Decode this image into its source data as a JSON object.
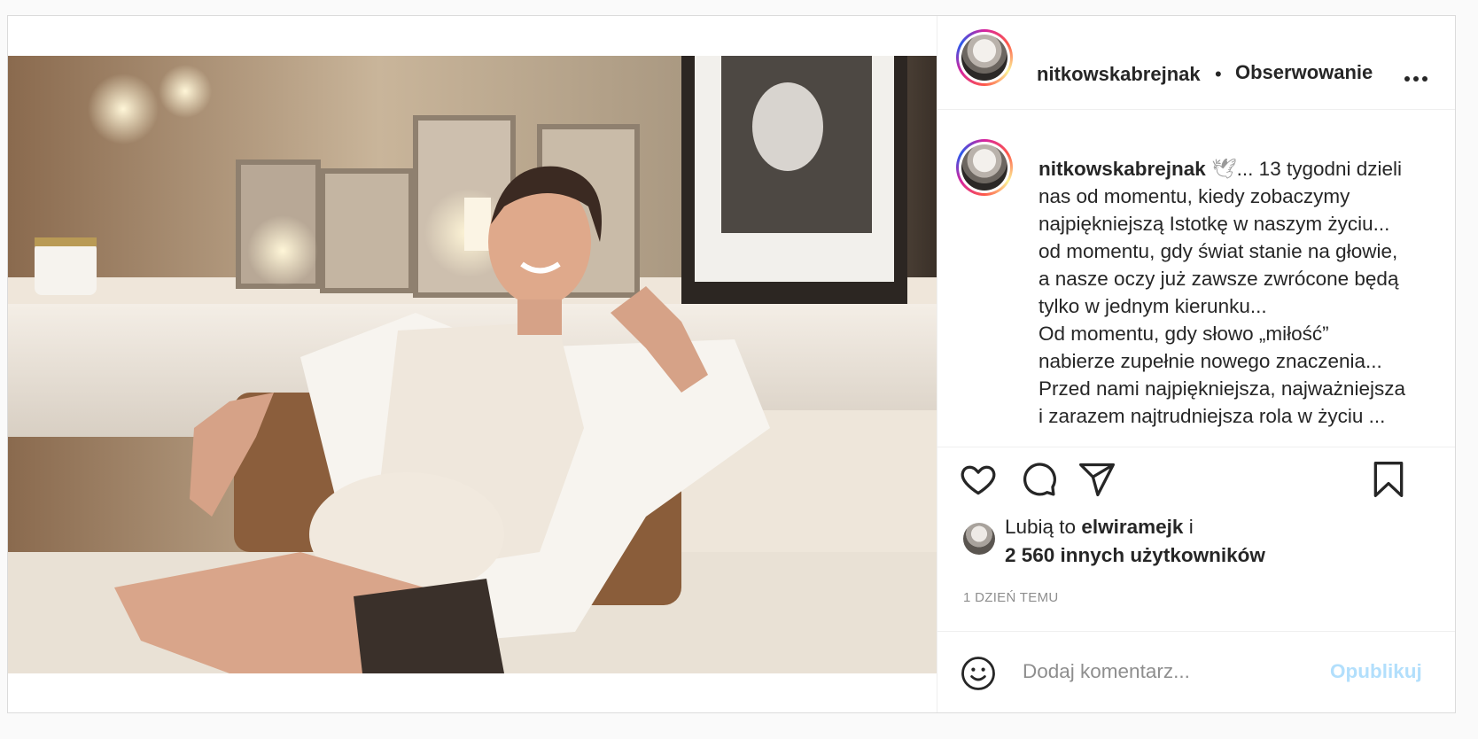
{
  "post": {
    "username": "nitkowskabrejnak",
    "separator": "•",
    "follow_label": "Obserwowanie",
    "more_icon": "more-horizontal-icon",
    "caption": {
      "username": "nitkowskabrejnak",
      "emoji": "🕊",
      "lines": [
        "... 13 tygodni dzieli",
        "nas od momentu, kiedy zobaczymy",
        "najpiękniejszą Istotkę w naszym życiu...",
        "od momentu, gdy świat stanie na głowie,",
        "a nasze oczy już zawsze zwrócone będą",
        "tylko w jednym kierunku...",
        "Od momentu, gdy słowo „miłość”",
        "nabierze zupełnie nowego znaczenia...",
        "Przed nami najpiękniejsza, najważniejsza",
        "i zarazem najtrudniejsza rola w życiu ..."
      ]
    },
    "actions": {
      "like_icon": "heart-icon",
      "comment_icon": "comment-icon",
      "share_icon": "paper-plane-icon",
      "save_icon": "bookmark-icon"
    },
    "likes": {
      "prefix": "Lubią to",
      "liker": "elwiramejk",
      "suffix": "i",
      "others": "2 560 innych użytkowników"
    },
    "timestamp": "1 DZIEŃ TEMU",
    "comment": {
      "emoji_icon": "smiley-icon",
      "placeholder": "Dodaj komentarz...",
      "publish_label": "Opublikuj"
    }
  },
  "colors": {
    "text": "#262626",
    "muted": "#8e8e8e",
    "publish_disabled": "#b2dffc",
    "border": "#dbdbdb"
  }
}
